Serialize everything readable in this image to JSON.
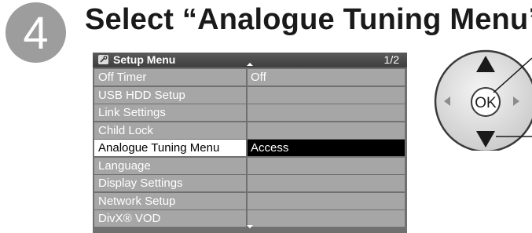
{
  "step": {
    "number": "4"
  },
  "heading": "Select “Analogue Tuning Menu”",
  "menu": {
    "title": "Setup Menu",
    "page": "1/2",
    "items": [
      {
        "label": "Off Timer",
        "value": "Off"
      },
      {
        "label": "USB HDD Setup",
        "value": ""
      },
      {
        "label": "Link Settings",
        "value": ""
      },
      {
        "label": "Child Lock",
        "value": ""
      },
      {
        "label": "Analogue Tuning Menu",
        "value": "Access",
        "selected": true
      },
      {
        "label": "Language",
        "value": ""
      },
      {
        "label": "Display Settings",
        "value": ""
      },
      {
        "label": "Network Setup",
        "value": ""
      },
      {
        "label": "DivX® VOD",
        "value": ""
      }
    ]
  },
  "remote": {
    "ok_label": "OK"
  },
  "colors": {
    "step_circle": "#9d9d9d",
    "menu_row": "#a6a6a6",
    "selected_label_bg": "#ffffff",
    "selected_value_bg": "#000000"
  }
}
